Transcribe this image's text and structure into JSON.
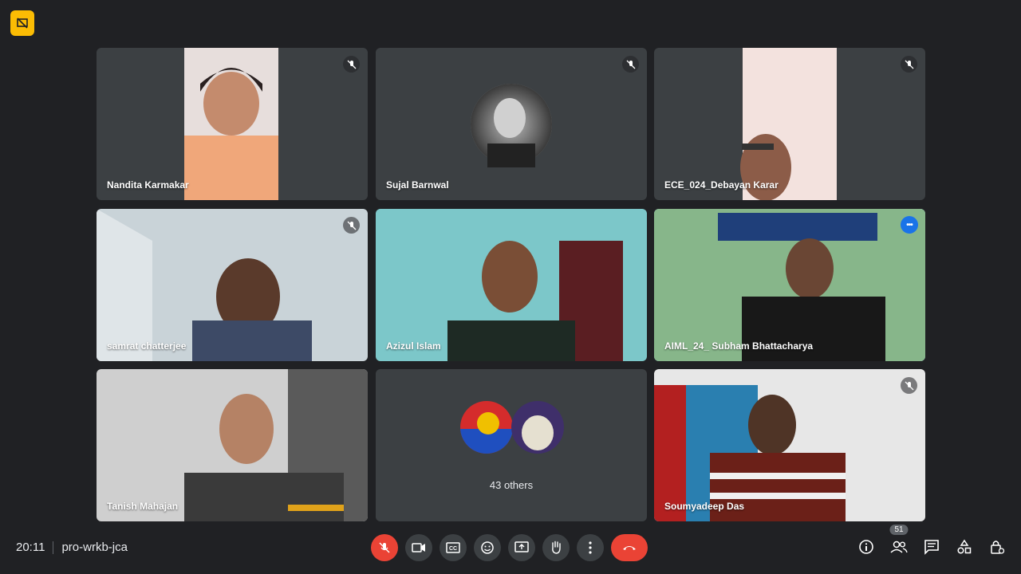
{
  "participants": [
    {
      "name": "Nandita Karmakar",
      "muted": true
    },
    {
      "name": "Sujal Barnwal",
      "muted": true
    },
    {
      "name": "ECE_024_Debayan Karar",
      "muted": true
    },
    {
      "name": "samrat chatterjee",
      "muted": true
    },
    {
      "name": "Azizul Islam",
      "muted": false
    },
    {
      "name": "AIML_24_ Subham Bhattacharya",
      "muted": false
    },
    {
      "name": "Tanish Mahajan",
      "muted": false
    },
    {
      "name": "Soumyadeep Das",
      "muted": true
    }
  ],
  "others": {
    "label": "43 others"
  },
  "meeting": {
    "time": "20:11",
    "code": "pro-wrkb-jca"
  },
  "people_count": "51",
  "colors": {
    "background": "#202124",
    "tile": "#3c4043",
    "accent_red": "#ea4335",
    "active_outline": "#8ab4f8",
    "badge_yellow": "#fbbc04"
  },
  "icons": {
    "top": "presentation-off-icon",
    "controls": [
      "mic-off-icon",
      "camera-icon",
      "captions-icon",
      "emoji-icon",
      "present-screen-icon",
      "raise-hand-icon",
      "more-options-icon",
      "end-call-icon"
    ],
    "right": [
      "info-icon",
      "people-icon",
      "chat-icon",
      "activities-icon",
      "host-controls-icon"
    ]
  }
}
